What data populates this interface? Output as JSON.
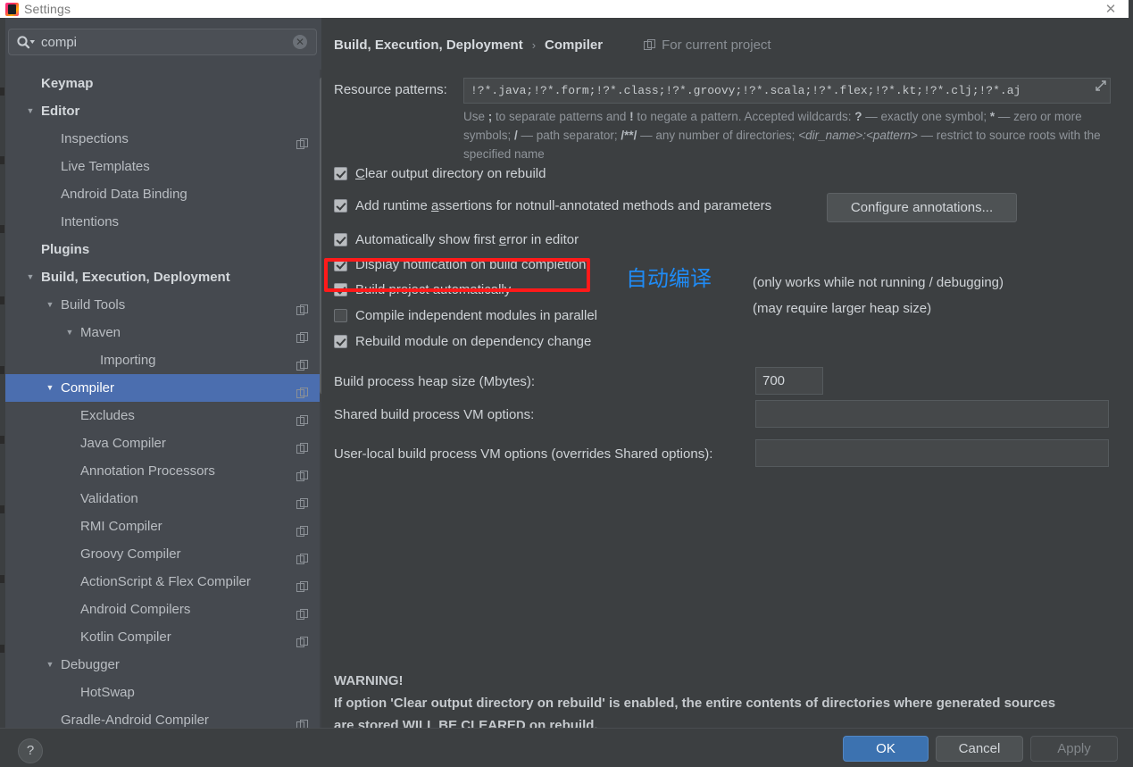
{
  "window": {
    "title": "Settings",
    "app_icon": "intellij-idea-logo-icon",
    "close_label": "✕"
  },
  "sidebar": {
    "search": {
      "value": "compi",
      "placeholder": "",
      "search_icon": "search-icon",
      "dropdown_icon": "chevron-down-icon",
      "clear_icon": "clear-circle-icon"
    },
    "items": [
      {
        "label": "Keymap",
        "indent": 0,
        "arrow": "",
        "bold": true,
        "copy_icon": false,
        "selected": false
      },
      {
        "label": "Editor",
        "indent": 0,
        "arrow": "▼",
        "bold": true,
        "copy_icon": false,
        "selected": false
      },
      {
        "label": "Inspections",
        "indent": 1,
        "arrow": "",
        "bold": false,
        "copy_icon": true,
        "selected": false
      },
      {
        "label": "Live Templates",
        "indent": 1,
        "arrow": "",
        "bold": false,
        "copy_icon": false,
        "selected": false
      },
      {
        "label": "Android Data Binding",
        "indent": 1,
        "arrow": "",
        "bold": false,
        "copy_icon": false,
        "selected": false
      },
      {
        "label": "Intentions",
        "indent": 1,
        "arrow": "",
        "bold": false,
        "copy_icon": false,
        "selected": false
      },
      {
        "label": "Plugins",
        "indent": 0,
        "arrow": "",
        "bold": true,
        "copy_icon": false,
        "selected": false
      },
      {
        "label": "Build, Execution, Deployment",
        "indent": 0,
        "arrow": "▼",
        "bold": true,
        "copy_icon": false,
        "selected": false
      },
      {
        "label": "Build Tools",
        "indent": 1,
        "arrow": "▼",
        "bold": false,
        "copy_icon": true,
        "selected": false
      },
      {
        "label": "Maven",
        "indent": 2,
        "arrow": "▼",
        "bold": false,
        "copy_icon": true,
        "selected": false
      },
      {
        "label": "Importing",
        "indent": 3,
        "arrow": "",
        "bold": false,
        "copy_icon": true,
        "selected": false
      },
      {
        "label": "Compiler",
        "indent": 1,
        "arrow": "▼",
        "bold": false,
        "copy_icon": true,
        "selected": true
      },
      {
        "label": "Excludes",
        "indent": 2,
        "arrow": "",
        "bold": false,
        "copy_icon": true,
        "selected": false
      },
      {
        "label": "Java Compiler",
        "indent": 2,
        "arrow": "",
        "bold": false,
        "copy_icon": true,
        "selected": false
      },
      {
        "label": "Annotation Processors",
        "indent": 2,
        "arrow": "",
        "bold": false,
        "copy_icon": true,
        "selected": false
      },
      {
        "label": "Validation",
        "indent": 2,
        "arrow": "",
        "bold": false,
        "copy_icon": true,
        "selected": false
      },
      {
        "label": "RMI Compiler",
        "indent": 2,
        "arrow": "",
        "bold": false,
        "copy_icon": true,
        "selected": false
      },
      {
        "label": "Groovy Compiler",
        "indent": 2,
        "arrow": "",
        "bold": false,
        "copy_icon": true,
        "selected": false
      },
      {
        "label": "ActionScript & Flex Compiler",
        "indent": 2,
        "arrow": "",
        "bold": false,
        "copy_icon": true,
        "selected": false
      },
      {
        "label": "Android Compilers",
        "indent": 2,
        "arrow": "",
        "bold": false,
        "copy_icon": true,
        "selected": false
      },
      {
        "label": "Kotlin Compiler",
        "indent": 2,
        "arrow": "",
        "bold": false,
        "copy_icon": true,
        "selected": false
      },
      {
        "label": "Debugger",
        "indent": 1,
        "arrow": "▼",
        "bold": false,
        "copy_icon": false,
        "selected": false
      },
      {
        "label": "HotSwap",
        "indent": 2,
        "arrow": "",
        "bold": false,
        "copy_icon": false,
        "selected": false
      },
      {
        "label": "Gradle-Android Compiler",
        "indent": 1,
        "arrow": "",
        "bold": false,
        "copy_icon": true,
        "selected": false
      }
    ]
  },
  "main": {
    "breadcrumb": {
      "parent": "Build, Execution, Deployment",
      "separator": "›",
      "current": "Compiler",
      "scope_hint": "For current project",
      "scope_icon": "copy-project-icon"
    },
    "resource_patterns": {
      "label": "Resource patterns:",
      "value": "!?*.java;!?*.form;!?*.class;!?*.groovy;!?*.scala;!?*.flex;!?*.kt;!?*.clj;!?*.aj",
      "expand_icon": "expand-arrow-icon",
      "hint_html": "Use <b>;</b> to separate patterns and <b>!</b> to negate a pattern. Accepted wildcards: <b>?</b> — exactly one symbol; <b>*</b> — zero or more symbols; <b>/</b> — path separator; <b>/**/</b> — any number of directories; <i>&lt;dir_name&gt;:&lt;pattern&gt;</i> — restrict to source roots with the specified name"
    },
    "checkboxes": [
      {
        "label": "Clear output directory on rebuild",
        "checked": true,
        "mnemonic": "C",
        "note": ""
      },
      {
        "label": "Add runtime assertions for notnull-annotated methods and parameters",
        "checked": true,
        "mnemonic": "a",
        "note": ""
      },
      {
        "label": "Automatically show first error in editor",
        "checked": true,
        "mnemonic": "e",
        "note": ""
      },
      {
        "label": "Display notification on build completion",
        "checked": true,
        "mnemonic": "",
        "note": ""
      },
      {
        "label": "Build project automatically",
        "checked": true,
        "mnemonic": "",
        "note": "(only works while not running / debugging)"
      },
      {
        "label": "Compile independent modules in parallel",
        "checked": false,
        "mnemonic": "",
        "note": "(may require larger heap size)"
      },
      {
        "label": "Rebuild module on dependency change",
        "checked": true,
        "mnemonic": "",
        "note": ""
      }
    ],
    "configure_annotations_button": "Configure annotations...",
    "fields": [
      {
        "label": "Build process heap size (Mbytes):",
        "value": "700"
      },
      {
        "label": "Shared build process VM options:",
        "value": ""
      },
      {
        "label": "User-local build process VM options (overrides Shared options):",
        "value": ""
      }
    ],
    "warning": {
      "heading": "WARNING!",
      "line1": "If option 'Clear output directory on rebuild' is enabled, the entire contents of directories where generated sources",
      "line2": "are stored WILL BE CLEARED on rebuild."
    }
  },
  "annotations": {
    "red_highlight_target": "Build project automatically",
    "chinese_note": "自动编译",
    "red_color": "#ff1a1a",
    "blue_color": "#1f8bf5"
  },
  "footer": {
    "help_label": "?",
    "ok_label": "OK",
    "cancel_label": "Cancel",
    "apply_label": "Apply"
  },
  "colors": {
    "panel_bg": "#3c3f41",
    "sidebar_bg": "#45494f",
    "selection_blue": "#4b6eaf",
    "primary_button": "#3c72b0"
  }
}
